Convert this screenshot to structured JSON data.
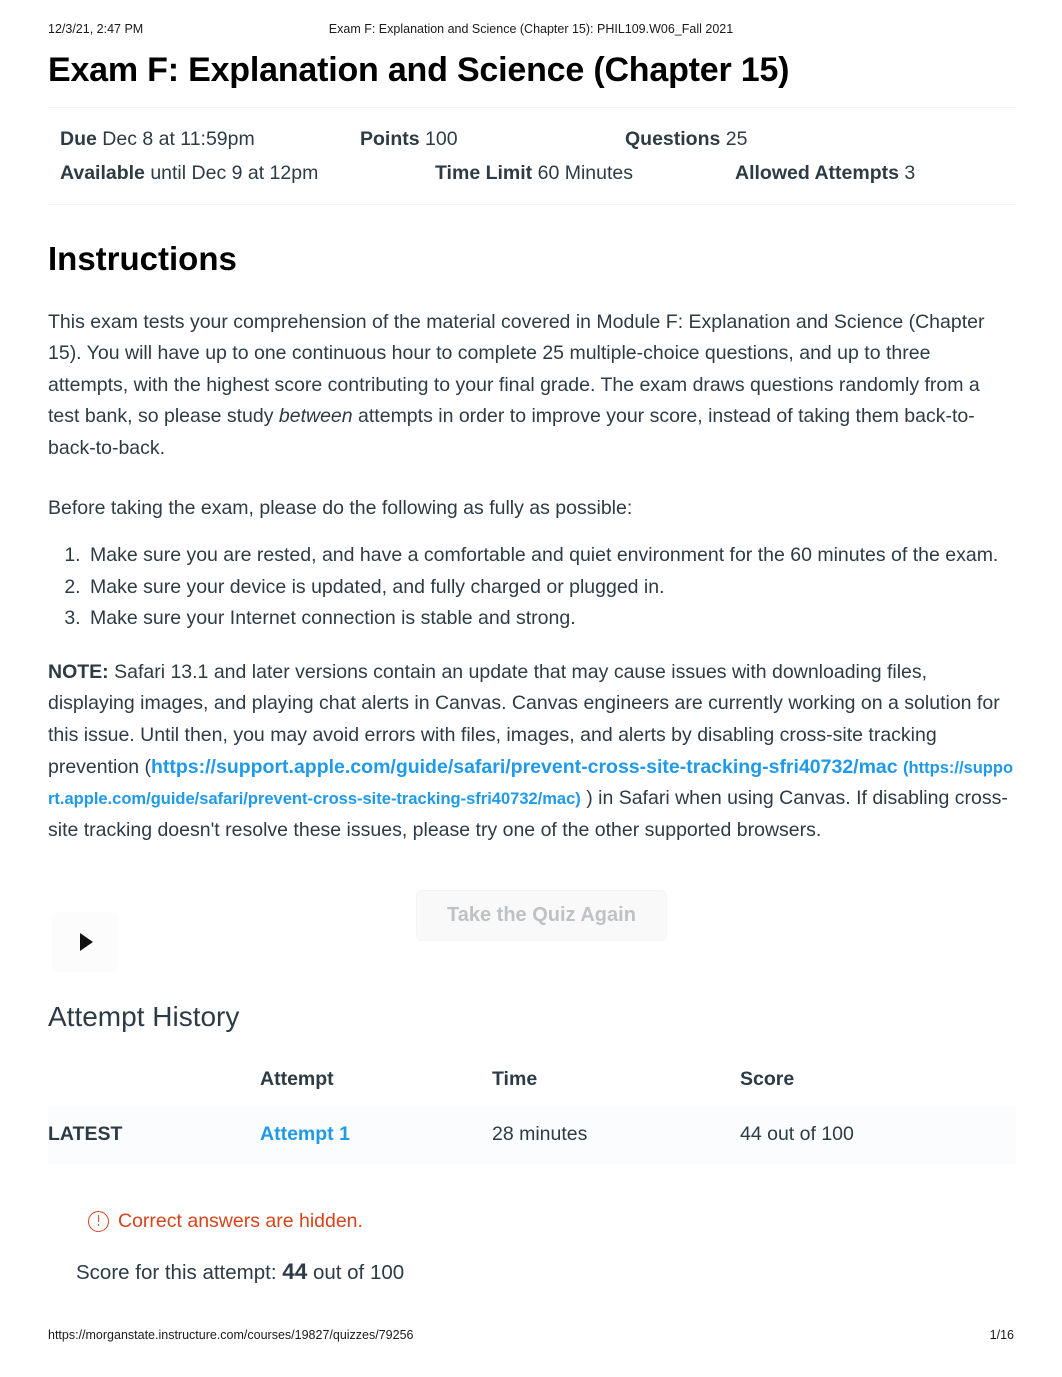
{
  "print_header": {
    "date": "12/3/21, 2:47 PM",
    "title": "Exam F: Explanation and Science (Chapter 15): PHIL109.W06_Fall 2021"
  },
  "quiz": {
    "title": "Exam F: Explanation and Science (Chapter 15)",
    "meta": {
      "due_label": "Due",
      "due_value": "Dec 8 at 11:59pm",
      "points_label": "Points",
      "points_value": "100",
      "questions_label": "Questions",
      "questions_value": "25",
      "available_label": "Available",
      "available_value": "until Dec 9 at 12pm",
      "time_limit_label": "Time Limit",
      "time_limit_value": "60 Minutes",
      "allowed_attempts_label": "Allowed Attempts",
      "allowed_attempts_value": "3"
    }
  },
  "instructions": {
    "heading": "Instructions",
    "paragraph_1_part_1": "This exam tests your comprehension of the material covered in Module F: Explanation and Science (Chapter 15). You will have up to one continuous hour to complete 25 multiple-choice questions, and up to three attempts, with the highest score contributing to your final grade. The exam draws questions randomly from a test bank, so please study ",
    "paragraph_1_italic": "between",
    "paragraph_1_part_2": " attempts in order to improve your score, instead of taking them back-to-back-to-back.",
    "paragraph_2": "Before taking the exam, please do the following as fully as possible:",
    "checklist": [
      "Make sure you are rested, and have a comfortable and quiet environment for the 60 minutes of the exam.",
      "Make sure your device is updated, and fully charged or plugged in.",
      "Make sure your Internet connection is stable and strong."
    ],
    "note_label": "NOTE:",
    "note_part_1": " Safari 13.1 and later versions contain an update that may cause issues with downloading files, displaying images, and playing chat alerts in Canvas. Canvas engineers are currently working on a solution for this issue. Until then, you may avoid errors with files, images, and alerts by disabling cross-site tracking prevention (",
    "note_link_text": "https://support.apple.com/guide/safari/prevent-cross-site-tracking-sfri40732/mac",
    "note_link_paren": "(https://support.apple.com/guide/safari/prevent-cross-site-tracking-sfri40732/mac)",
    "note_part_2": " ) in Safari when using Canvas. If disabling cross-site tracking doesn't resolve these issues, please try one of the other supported browsers."
  },
  "actions": {
    "take_quiz_again_label": "Take the Quiz Again",
    "play_icon": "play-triangle-icon"
  },
  "attempt_history": {
    "heading": "Attempt History",
    "columns": [
      "",
      "Attempt",
      "Time",
      "Score"
    ],
    "rows": [
      {
        "status": "LATEST",
        "attempt": "Attempt 1",
        "time": "28 minutes",
        "score": "44 out of 100"
      }
    ]
  },
  "result": {
    "answers_hidden_text": "Correct answers are hidden.",
    "warning_icon": "exclamation-circle-icon",
    "score_prefix": "Score for this attempt: ",
    "score_value": "44",
    "score_suffix": " out of 100"
  },
  "print_footer": {
    "url": "https://morganstate.instructure.com/courses/19827/quizzes/79256",
    "page": "1/16"
  },
  "colors": {
    "link": "#1f9ae8",
    "warning": "#d9431b",
    "text": "#2d3b45",
    "disabled_button_text": "#a9aeb2"
  }
}
